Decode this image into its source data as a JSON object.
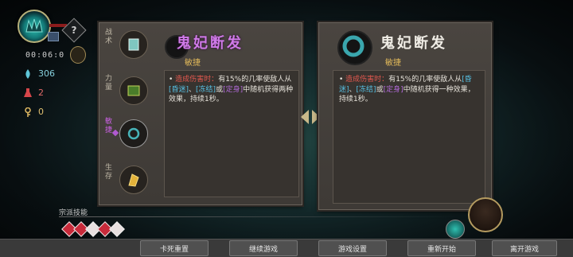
{
  "hud": {
    "timer": "00:06:0",
    "cells": "306",
    "health_potions": "2",
    "keys": "0"
  },
  "categories": [
    {
      "label": "战术",
      "active": false
    },
    {
      "label": "力量",
      "active": false
    },
    {
      "label": "敏捷",
      "active": true
    },
    {
      "label": "生存",
      "active": false
    }
  ],
  "left_item": {
    "name": "鬼妃断发",
    "type": "敏捷",
    "desc_parts": [
      {
        "text": "• ",
        "cls": ""
      },
      {
        "text": "造成伤害时：",
        "cls": "red"
      },
      {
        "text": "有15%的几率使敌人从",
        "cls": ""
      },
      {
        "text": "[昏迷]",
        "cls": "cyan"
      },
      {
        "text": "、",
        "cls": ""
      },
      {
        "text": "[冻结]",
        "cls": "cyan"
      },
      {
        "text": "或",
        "cls": ""
      },
      {
        "text": "[定身]",
        "cls": "purple"
      },
      {
        "text": "中随机获得两种效果，持续1秒。",
        "cls": ""
      }
    ]
  },
  "right_item": {
    "name": "鬼妃断发",
    "type": "敏捷",
    "desc_parts": [
      {
        "text": "• ",
        "cls": ""
      },
      {
        "text": "造成伤害时：",
        "cls": "red"
      },
      {
        "text": "有15%的几率使敌人从",
        "cls": ""
      },
      {
        "text": "[昏迷]",
        "cls": "cyan"
      },
      {
        "text": "、",
        "cls": ""
      },
      {
        "text": "[冻结]",
        "cls": "cyan"
      },
      {
        "text": "或",
        "cls": ""
      },
      {
        "text": "[定身]",
        "cls": "purple"
      },
      {
        "text": "中随机获得一种效果，持续1秒。",
        "cls": ""
      }
    ]
  },
  "faction": {
    "label": "宗派技能",
    "gems": [
      "#c82a3a",
      "#c82a3a",
      "#e8e0e0",
      "#c82a3a",
      "#e8e0e0"
    ]
  },
  "bottom_buttons": [
    "卡死重置",
    "继续游戏",
    "游戏设置",
    "重新开始",
    "离开游戏"
  ],
  "colors": {
    "accent_purple": "#d07ae8",
    "gold": "#e0b85a"
  }
}
